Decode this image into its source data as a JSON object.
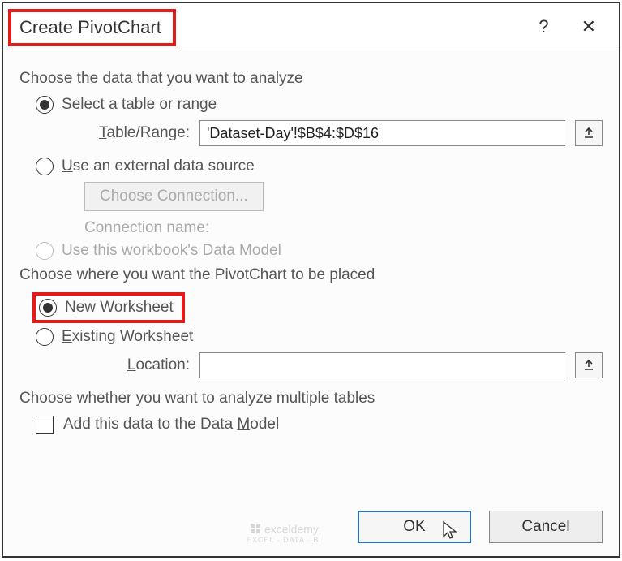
{
  "titlebar": {
    "title": "Create PivotChart",
    "help": "?",
    "close": "✕"
  },
  "section1": {
    "heading": "Choose the data that you want to analyze",
    "opt_select": "elect a table or range",
    "opt_select_u": "S",
    "table_range_label_u": "T",
    "table_range_label": "able/Range:",
    "table_range_value": "'Dataset-Day'!$B$4:$D$16",
    "opt_external_u": "U",
    "opt_external": "se an external data source",
    "choose_conn": "Choose Connection...",
    "conn_name": "Connection name:",
    "opt_datamodel": "Use this workbook's Data Model"
  },
  "section2": {
    "heading": "Choose where you want the PivotChart to be placed",
    "opt_new_u": "N",
    "opt_new": "ew Worksheet",
    "opt_existing_u": "E",
    "opt_existing": "xisting Worksheet",
    "location_label_u": "L",
    "location_label": "ocation:",
    "location_value": ""
  },
  "section3": {
    "heading": "Choose whether you want to analyze multiple tables",
    "chk_label_pre": "Add this data to the Data ",
    "chk_label_u": "M",
    "chk_label_post": "odel"
  },
  "buttons": {
    "ok": "OK",
    "cancel": "Cancel"
  },
  "watermark": {
    "main": "exceldemy",
    "sub": "EXCEL · DATA · BI"
  }
}
